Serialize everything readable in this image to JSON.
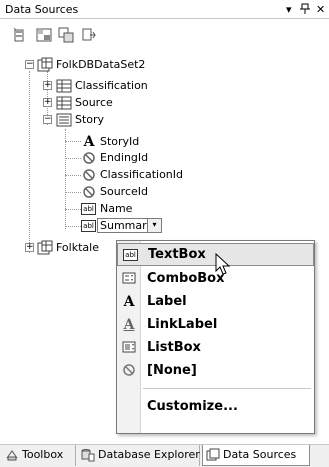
{
  "window": {
    "title": "Data Sources",
    "pin_glyph": "▾ ⊥",
    "close_glyph": "✕"
  },
  "toolbar": {
    "buttons": [
      "add-new-data-source-icon",
      "edit-dataset-with-designer-icon",
      "configure-dataset-with-wizard-icon",
      "refresh-icon"
    ]
  },
  "tree": {
    "root": {
      "label": "FolkDBDataSet2",
      "expander": "−"
    },
    "tables": [
      {
        "label": "Classification",
        "expander": "+"
      },
      {
        "label": "Source",
        "expander": "+"
      },
      {
        "label": "Story",
        "expander": "−"
      }
    ],
    "story_fields": [
      {
        "label": "StoryId",
        "icon": "A"
      },
      {
        "label": "EndingId",
        "icon": "none"
      },
      {
        "label": "ClassificationId",
        "icon": "none"
      },
      {
        "label": "SourceId",
        "icon": "none"
      },
      {
        "label": "Name",
        "icon": "abl"
      },
      {
        "label": "Summary",
        "icon": "abl"
      }
    ],
    "second_root": {
      "label": "Folktale",
      "expander": "+"
    }
  },
  "dropdown": {
    "selected_field": "Summary",
    "arrow": "▾"
  },
  "menu": {
    "items": [
      {
        "label": "TextBox",
        "icon": "abl",
        "hover": true
      },
      {
        "label": "ComboBox",
        "icon": "combo"
      },
      {
        "label": "Label",
        "icon": "A"
      },
      {
        "label": "LinkLabel",
        "icon": "A"
      },
      {
        "label": "ListBox",
        "icon": "list"
      },
      {
        "label": "[None]",
        "icon": "none"
      }
    ],
    "customize_label": "Customize..."
  },
  "tabs": [
    {
      "label": "Toolbox"
    },
    {
      "label": "Database Explorer"
    },
    {
      "label": "Data Sources",
      "active": true
    }
  ]
}
